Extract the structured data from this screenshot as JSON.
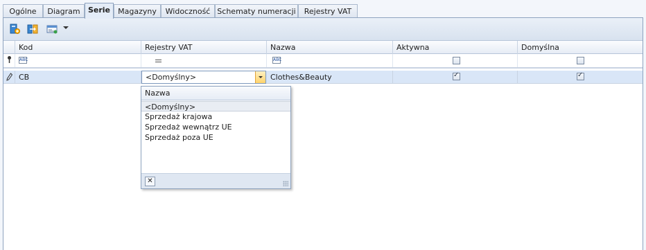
{
  "tabs": [
    "Ogólne",
    "Diagram",
    "Serie",
    "Magazyny",
    "Widoczność",
    "Schematy numeracji",
    "Rejestry VAT"
  ],
  "active_tab": "Serie",
  "toolbar": {
    "icons": [
      "add-series-icon",
      "edit-series-icon",
      "view-options-icon",
      "dropdown-arrow-icon"
    ]
  },
  "grid": {
    "columns": [
      "Kod",
      "Rejestry VAT",
      "Nazwa",
      "Aktywna",
      "Domyślna"
    ],
    "filter_row": {
      "kod_icon": "text-filter-icon",
      "rejestry_icon": "equals-filter-icon",
      "nazwa_icon": "text-filter-icon",
      "aktywna": false,
      "domyslna": false
    },
    "rows": [
      {
        "kod": "CB",
        "rejestry_vat": "<Domyślny>",
        "nazwa": "Clothes&Beauty",
        "aktywna": true,
        "domyslna": true
      }
    ]
  },
  "dropdown": {
    "header": "Nazwa",
    "options": [
      "<Domyślny>",
      "Sprzedaż krajowa",
      "Sprzedaż wewnątrz UE",
      "Sprzedaż poza UE"
    ],
    "selected": "<Domyślny>"
  },
  "colors": {
    "row_highlight": "#d9e6f7",
    "combo_button": "#ffd36b",
    "frame_border": "#8ea3bf"
  }
}
